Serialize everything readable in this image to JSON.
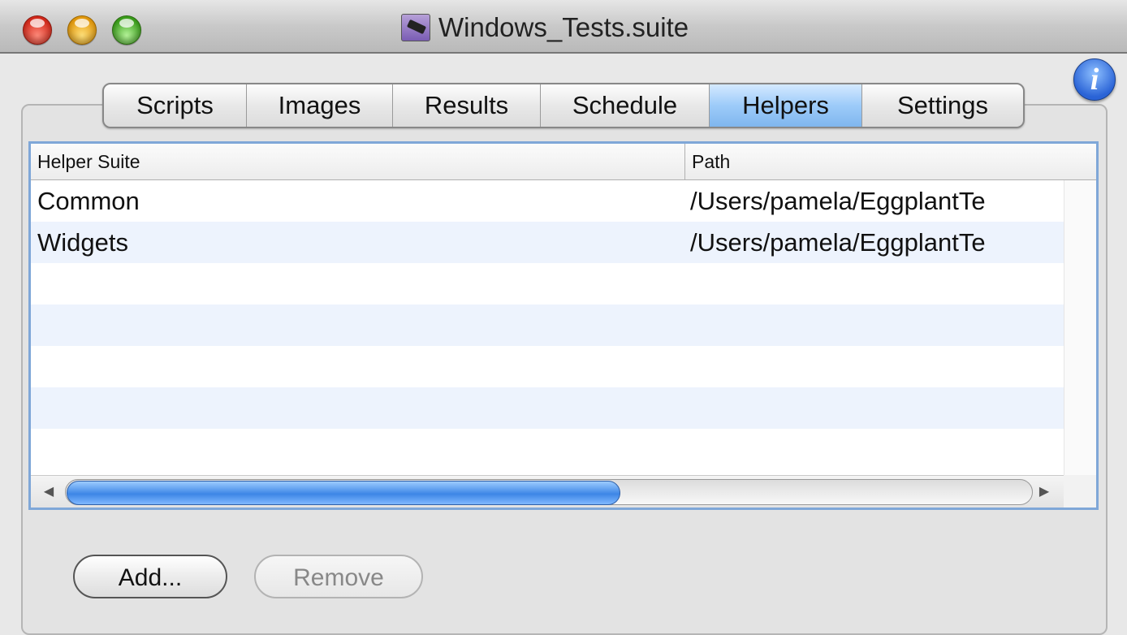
{
  "window": {
    "title": "Windows_Tests.suite",
    "title_icon": "suite-document-icon"
  },
  "tabs": [
    {
      "label": "Scripts",
      "selected": false
    },
    {
      "label": "Images",
      "selected": false
    },
    {
      "label": "Results",
      "selected": false
    },
    {
      "label": "Schedule",
      "selected": false
    },
    {
      "label": "Helpers",
      "selected": true
    },
    {
      "label": "Settings",
      "selected": false
    }
  ],
  "info_button": {
    "label": "i"
  },
  "table": {
    "columns": [
      "Helper Suite",
      "Path"
    ],
    "rows": [
      {
        "suite": "Common",
        "path": "/Users/pamela/EggplantTe"
      },
      {
        "suite": "Widgets",
        "path": "/Users/pamela/EggplantTe"
      }
    ]
  },
  "scrollbar": {
    "left_arrow": "◀",
    "right_arrow": "▶"
  },
  "buttons": {
    "add_label": "Add...",
    "remove_label": "Remove"
  },
  "colors": {
    "selected_tab": "#9dcbf9",
    "table_border": "#7fa7d8",
    "alt_row": "#edf3fd",
    "scroll_thumb": "#3d86e6"
  }
}
